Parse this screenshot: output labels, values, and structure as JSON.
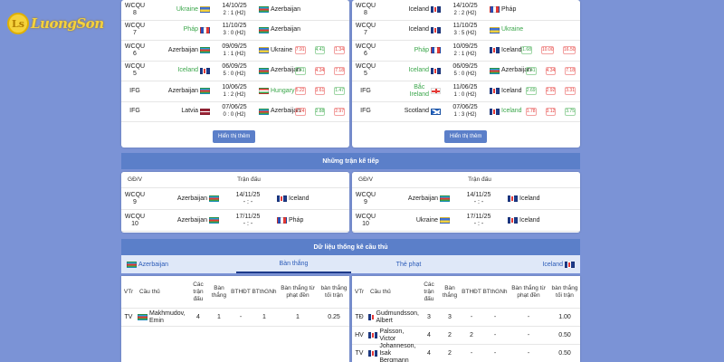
{
  "brand": {
    "mark": "Ls",
    "name": "LuongSon"
  },
  "left_history": [
    {
      "comp": "WCQU\n8",
      "home": "Ukraine",
      "home_flag": "ua",
      "home_win": true,
      "date": "14/10/25",
      "score": "2 : 1 (H2)",
      "away": "Azerbaijan",
      "away_flag": "az",
      "away_win": false,
      "odds": []
    },
    {
      "comp": "WCQU\n7",
      "home": "Pháp",
      "home_flag": "fr",
      "home_win": true,
      "date": "11/10/25",
      "score": "3 : 0 (H2)",
      "away": "Azerbaijan",
      "away_flag": "az",
      "away_win": false,
      "odds": []
    },
    {
      "comp": "WCQU\n6",
      "home": "Azerbaijan",
      "home_flag": "az",
      "home_win": false,
      "date": "09/09/25",
      "score": "1 : 1 (H2)",
      "away": "Ukraine",
      "away_flag": "ua",
      "away_win": false,
      "odds": [
        [
          "7.91",
          "r"
        ],
        [
          "4.41",
          "g"
        ],
        [
          "1.34",
          "r"
        ]
      ]
    },
    {
      "comp": "WCQU\n5",
      "home": "Iceland",
      "home_flag": "is",
      "home_win": true,
      "date": "06/09/25",
      "score": "5 : 0 (H2)",
      "away": "Azerbaijan",
      "away_flag": "az",
      "away_win": false,
      "odds": [
        [
          "1.41",
          "g"
        ],
        [
          "4.34",
          "r"
        ],
        [
          "7.18",
          "r"
        ]
      ]
    },
    {
      "comp": "IFG",
      "home": "Azerbaijan",
      "home_flag": "az",
      "home_win": false,
      "date": "10/06/25",
      "score": "1 : 2 (H2)",
      "away": "Hungary",
      "away_flag": "hu",
      "away_win": true,
      "odds": [
        [
          "5.22",
          "r"
        ],
        [
          "3.61",
          "r"
        ],
        [
          "1.47",
          "g"
        ]
      ]
    },
    {
      "comp": "IFG",
      "home": "Latvia",
      "home_flag": "lv",
      "home_win": false,
      "date": "07/06/25",
      "score": "0 : 0 (H2)",
      "away": "Azerbaijan",
      "away_flag": "az",
      "away_win": false,
      "odds": [
        [
          "2.24",
          "r"
        ],
        [
          "2.88",
          "g"
        ],
        [
          "2.97",
          "r"
        ]
      ]
    }
  ],
  "right_history": [
    {
      "comp": "WCQU\n8",
      "home": "Iceland",
      "home_flag": "is",
      "home_win": false,
      "date": "14/10/25",
      "score": "2 : 2 (H2)",
      "away": "Pháp",
      "away_flag": "fr",
      "away_win": false,
      "odds": []
    },
    {
      "comp": "WCQU\n7",
      "home": "Iceland",
      "home_flag": "is",
      "home_win": false,
      "date": "11/10/25",
      "score": "3 : 5 (H2)",
      "away": "Ukraine",
      "away_flag": "ua",
      "away_win": true,
      "odds": []
    },
    {
      "comp": "WCQU\n6",
      "home": "Pháp",
      "home_flag": "fr",
      "home_win": true,
      "date": "10/09/25",
      "score": "2 : 1 (H2)",
      "away": "Iceland",
      "away_flag": "is",
      "away_win": false,
      "odds": [
        [
          "1.68",
          "g"
        ],
        [
          "10.00",
          "r"
        ],
        [
          "16.50",
          "r"
        ]
      ]
    },
    {
      "comp": "WCQU\n5",
      "home": "Iceland",
      "home_flag": "is",
      "home_win": true,
      "date": "06/09/25",
      "score": "5 : 0 (H2)",
      "away": "Azerbaijan",
      "away_flag": "az",
      "away_win": false,
      "odds": [
        [
          "1.41",
          "g"
        ],
        [
          "4.34",
          "r"
        ],
        [
          "7.18",
          "r"
        ]
      ]
    },
    {
      "comp": "IFG",
      "home": "Bắc\nIreland",
      "home_flag": "ni",
      "home_win": true,
      "date": "11/06/25",
      "score": "1 : 0 (H2)",
      "away": "Iceland",
      "away_flag": "is",
      "away_win": false,
      "odds": [
        [
          "2.69",
          "g"
        ],
        [
          "2.92",
          "r"
        ],
        [
          "3.31",
          "r"
        ]
      ]
    },
    {
      "comp": "IFG",
      "home": "Scotland",
      "home_flag": "sc",
      "home_win": false,
      "date": "07/06/25",
      "score": "1 : 3 (H2)",
      "away": "Iceland",
      "away_flag": "is",
      "away_win": true,
      "odds": [
        [
          "1.78",
          "r"
        ],
        [
          "3.12",
          "r"
        ],
        [
          "3.75",
          "g"
        ]
      ]
    }
  ],
  "show_more_label": "Hiển thị thêm",
  "upcoming_title": "Những trận kế tiếp",
  "upcoming_headers": {
    "comp": "GĐ/V",
    "match": "Trận đấu"
  },
  "left_upcoming": [
    {
      "comp": "WCQU\n9",
      "home": "Azerbaijan",
      "home_flag": "az",
      "date": "14/11/25",
      "score": "- : -",
      "away": "Iceland",
      "away_flag": "is"
    },
    {
      "comp": "WCQU\n10",
      "home": "Azerbaijan",
      "home_flag": "az",
      "date": "17/11/25",
      "score": "- : -",
      "away": "Pháp",
      "away_flag": "fr"
    }
  ],
  "right_upcoming": [
    {
      "comp": "WCQU\n9",
      "home": "Azerbaijan",
      "home_flag": "az",
      "date": "14/11/25",
      "score": "- : -",
      "away": "Iceland",
      "away_flag": "is"
    },
    {
      "comp": "WCQU\n10",
      "home": "Ukraine",
      "home_flag": "ua",
      "date": "17/11/25",
      "score": "- : -",
      "away": "Iceland",
      "away_flag": "is"
    }
  ],
  "stats_title": "Dữ liệu thống kê cầu thủ",
  "stats_tabs": {
    "team_left": "Azerbaijan",
    "goals": "Bàn thắng",
    "cards": "Thẻ phạt",
    "team_right": "Iceland"
  },
  "stats_headers": [
    "VTr",
    "Cầu thủ",
    "Các\ntrận\nđấu",
    "Bàn\nthắng",
    "BTHĐT",
    "BTthGNh",
    "Bàn thắng từ\nphạt đền",
    "bàn thắng\ntối trận"
  ],
  "left_players": [
    {
      "pos": "TV",
      "name": "Makhmudov,\nEmin",
      "flag": "az",
      "matches": "4",
      "goals": "1",
      "bthdt": "-",
      "btgnh": "1",
      "pen": "1",
      "avg": "0.25"
    }
  ],
  "right_players": [
    {
      "pos": "TĐ",
      "name": "Gudmundsson,\nAlbert",
      "flag": "is",
      "matches": "3",
      "goals": "3",
      "bthdt": "-",
      "btgnh": "-",
      "pen": "-",
      "avg": "1.00"
    },
    {
      "pos": "HV",
      "name": "Palsson, Victor",
      "flag": "is",
      "matches": "4",
      "goals": "2",
      "bthdt": "2",
      "btgnh": "-",
      "pen": "-",
      "avg": "0.50"
    },
    {
      "pos": "TV",
      "name": "Johanneson,\nIsak Bergmann",
      "flag": "is",
      "matches": "4",
      "goals": "2",
      "bthdt": "-",
      "btgnh": "-",
      "pen": "-",
      "avg": "0.50"
    }
  ]
}
